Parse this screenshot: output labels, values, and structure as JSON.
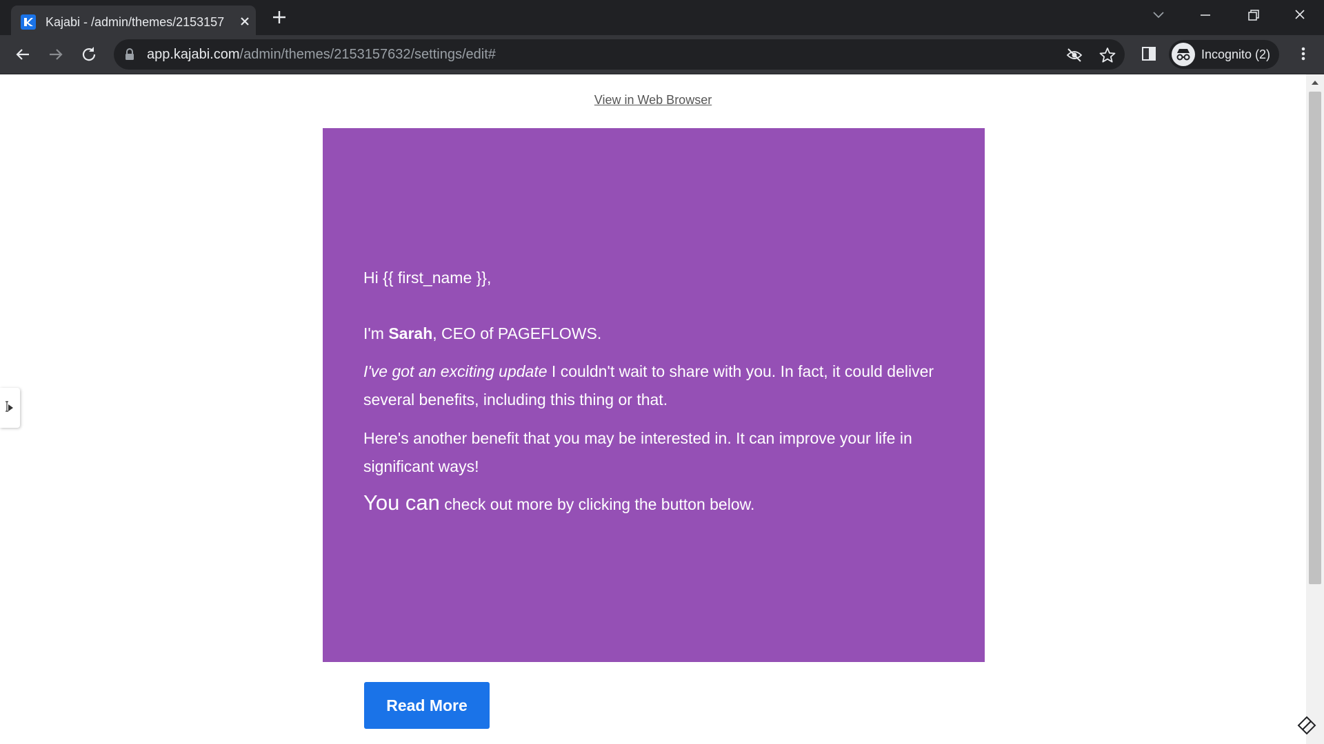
{
  "browser": {
    "tab": {
      "title": "Kajabi - /admin/themes/2153157",
      "favicon": "kajabi-k-icon"
    },
    "url": {
      "host": "app.kajabi.com",
      "path": "/admin/themes/2153157632/settings/edit#"
    },
    "profile": {
      "label": "Incognito (2)"
    }
  },
  "email": {
    "view_link": "View in Web Browser",
    "greeting": "Hi {{ first_name }},",
    "intro": {
      "pre": "I'm ",
      "name": "Sarah",
      "post": ", CEO of PAGEFLOWS."
    },
    "update": {
      "emphasis": "I've got an exciting update",
      "rest": " I couldn't wait to share with you. In fact, it could deliver several benefits, including this thing or that."
    },
    "benefit": "Here's another benefit that you may be interested in. It can improve your life in significant ways!",
    "cta": {
      "large": "You can",
      "rest": " check out more by clicking the button below."
    },
    "button_label": "Read More",
    "colors": {
      "card": "#9550b5",
      "button": "#1a73e8"
    }
  }
}
